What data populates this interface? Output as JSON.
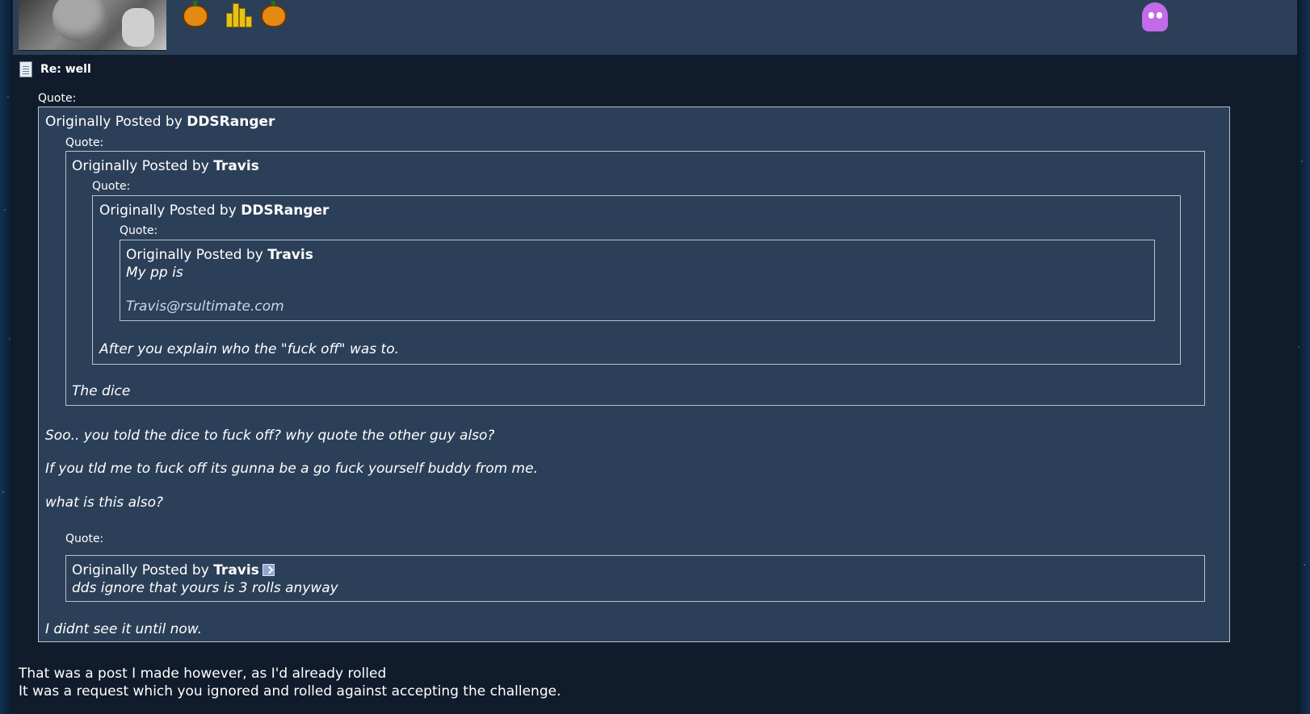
{
  "post": {
    "title": "Re: well",
    "quote_label": "Quote:",
    "q1_author_prefix": "Originally Posted by ",
    "q1_author": "DDSRanger",
    "q2_author_prefix": "Originally Posted by ",
    "q2_author": "Travis",
    "q3_author_prefix": "Originally Posted by ",
    "q3_author": "DDSRanger",
    "q4_author_prefix": "Originally Posted by ",
    "q4_author": "Travis",
    "q4_line1": "My pp is",
    "q4_email": "Travis@rsultimate.com",
    "q3_text": "After you explain who the \"fuck off\" was to.",
    "q2_text": "The dice",
    "q1_text_1": "Soo.. you told the dice to fuck off? why quote the other guy also?",
    "q1_text_2": "If you tld me to fuck off its gunna be a go fuck yourself buddy from me.",
    "q1_text_3": "what is this also?",
    "q5_author_prefix": "Originally Posted by ",
    "q5_author": "Travis",
    "q5_text": "dds ignore that yours is 3 rolls anyway",
    "q1_text_4": "I didnt see it until now.",
    "reply_1": "That was a post I made however, as I'd already rolled",
    "reply_2": "It was a request which you ignored and rolled against accepting the challenge."
  },
  "icons": [
    "doc-icon",
    "pumpkin-icon",
    "gold-coins-icon",
    "ghost-icon",
    "view-post-arrow-icon"
  ],
  "colors": {
    "panel": "#2c3f58",
    "background": "#101b2b",
    "border": "#b7c2ce"
  }
}
